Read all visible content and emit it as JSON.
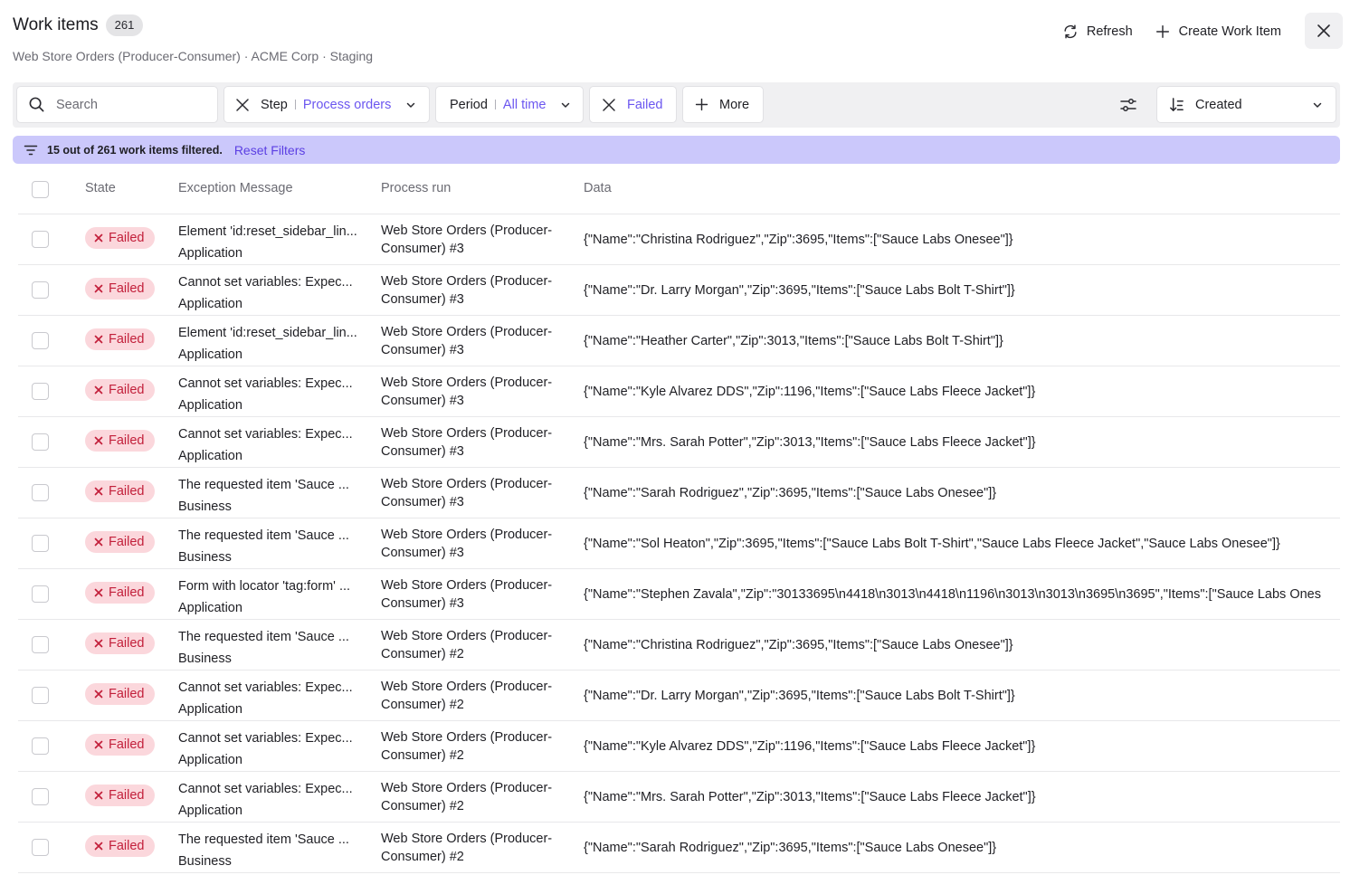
{
  "header": {
    "title": "Work items",
    "count": "261",
    "subtitle": "Web Store Orders (Producer-Consumer) · ACME Corp · Staging",
    "refresh_label": "Refresh",
    "create_label": "Create Work Item"
  },
  "filters": {
    "search_placeholder": "Search",
    "step_label": "Step",
    "step_value": "Process orders",
    "period_label": "Period",
    "period_value": "All time",
    "failed_value": "Failed",
    "more_label": "More",
    "sort_label": "Created"
  },
  "banner": {
    "message": "15 out of 261 work items filtered.",
    "reset_label": "Reset Filters"
  },
  "table": {
    "columns": [
      "State",
      "Exception Message",
      "Process run",
      "Data"
    ],
    "rows": [
      {
        "state": "Failed",
        "exception": "Element 'id:reset_sidebar_lin...",
        "type": "Application",
        "run": "Web Store Orders (Producer-Consumer) #3",
        "data": "{\"Name\":\"Christina Rodriguez\",\"Zip\":3695,\"Items\":[\"Sauce Labs Onesee\"]}"
      },
      {
        "state": "Failed",
        "exception": "Cannot set variables: Expec...",
        "type": "Application",
        "run": "Web Store Orders (Producer-Consumer) #3",
        "data": "{\"Name\":\"Dr. Larry Morgan\",\"Zip\":3695,\"Items\":[\"Sauce Labs Bolt T-Shirt\"]}"
      },
      {
        "state": "Failed",
        "exception": "Element 'id:reset_sidebar_lin...",
        "type": "Application",
        "run": "Web Store Orders (Producer-Consumer) #3",
        "data": "{\"Name\":\"Heather Carter\",\"Zip\":3013,\"Items\":[\"Sauce Labs Bolt T-Shirt\"]}"
      },
      {
        "state": "Failed",
        "exception": "Cannot set variables: Expec...",
        "type": "Application",
        "run": "Web Store Orders (Producer-Consumer) #3",
        "data": "{\"Name\":\"Kyle Alvarez DDS\",\"Zip\":1196,\"Items\":[\"Sauce Labs Fleece Jacket\"]}"
      },
      {
        "state": "Failed",
        "exception": "Cannot set variables: Expec...",
        "type": "Application",
        "run": "Web Store Orders (Producer-Consumer) #3",
        "data": "{\"Name\":\"Mrs. Sarah Potter\",\"Zip\":3013,\"Items\":[\"Sauce Labs Fleece Jacket\"]}"
      },
      {
        "state": "Failed",
        "exception": "The requested item 'Sauce ...",
        "type": "Business",
        "run": "Web Store Orders (Producer-Consumer) #3",
        "data": "{\"Name\":\"Sarah Rodriguez\",\"Zip\":3695,\"Items\":[\"Sauce Labs Onesee\"]}"
      },
      {
        "state": "Failed",
        "exception": "The requested item 'Sauce ...",
        "type": "Business",
        "run": "Web Store Orders (Producer-Consumer) #3",
        "data": "{\"Name\":\"Sol Heaton\",\"Zip\":3695,\"Items\":[\"Sauce Labs Bolt T-Shirt\",\"Sauce Labs Fleece Jacket\",\"Sauce Labs Onesee\"]}"
      },
      {
        "state": "Failed",
        "exception": "Form with locator 'tag:form' ...",
        "type": "Application",
        "run": "Web Store Orders (Producer-Consumer) #3",
        "data": "{\"Name\":\"Stephen Zavala\",\"Zip\":\"30133695\\n4418\\n3013\\n4418\\n1196\\n3013\\n3013\\n3695\\n3695\",\"Items\":[\"Sauce Labs Ones"
      },
      {
        "state": "Failed",
        "exception": "The requested item 'Sauce ...",
        "type": "Business",
        "run": "Web Store Orders (Producer-Consumer) #2",
        "data": "{\"Name\":\"Christina Rodriguez\",\"Zip\":3695,\"Items\":[\"Sauce Labs Onesee\"]}"
      },
      {
        "state": "Failed",
        "exception": "Cannot set variables: Expec...",
        "type": "Application",
        "run": "Web Store Orders (Producer-Consumer) #2",
        "data": "{\"Name\":\"Dr. Larry Morgan\",\"Zip\":3695,\"Items\":[\"Sauce Labs Bolt T-Shirt\"]}"
      },
      {
        "state": "Failed",
        "exception": "Cannot set variables: Expec...",
        "type": "Application",
        "run": "Web Store Orders (Producer-Consumer) #2",
        "data": "{\"Name\":\"Kyle Alvarez DDS\",\"Zip\":1196,\"Items\":[\"Sauce Labs Fleece Jacket\"]}"
      },
      {
        "state": "Failed",
        "exception": "Cannot set variables: Expec...",
        "type": "Application",
        "run": "Web Store Orders (Producer-Consumer) #2",
        "data": "{\"Name\":\"Mrs. Sarah Potter\",\"Zip\":3013,\"Items\":[\"Sauce Labs Fleece Jacket\"]}"
      },
      {
        "state": "Failed",
        "exception": "The requested item 'Sauce ...",
        "type": "Business",
        "run": "Web Store Orders (Producer-Consumer) #2",
        "data": "{\"Name\":\"Sarah Rodriguez\",\"Zip\":3695,\"Items\":[\"Sauce Labs Onesee\"]}"
      }
    ]
  }
}
